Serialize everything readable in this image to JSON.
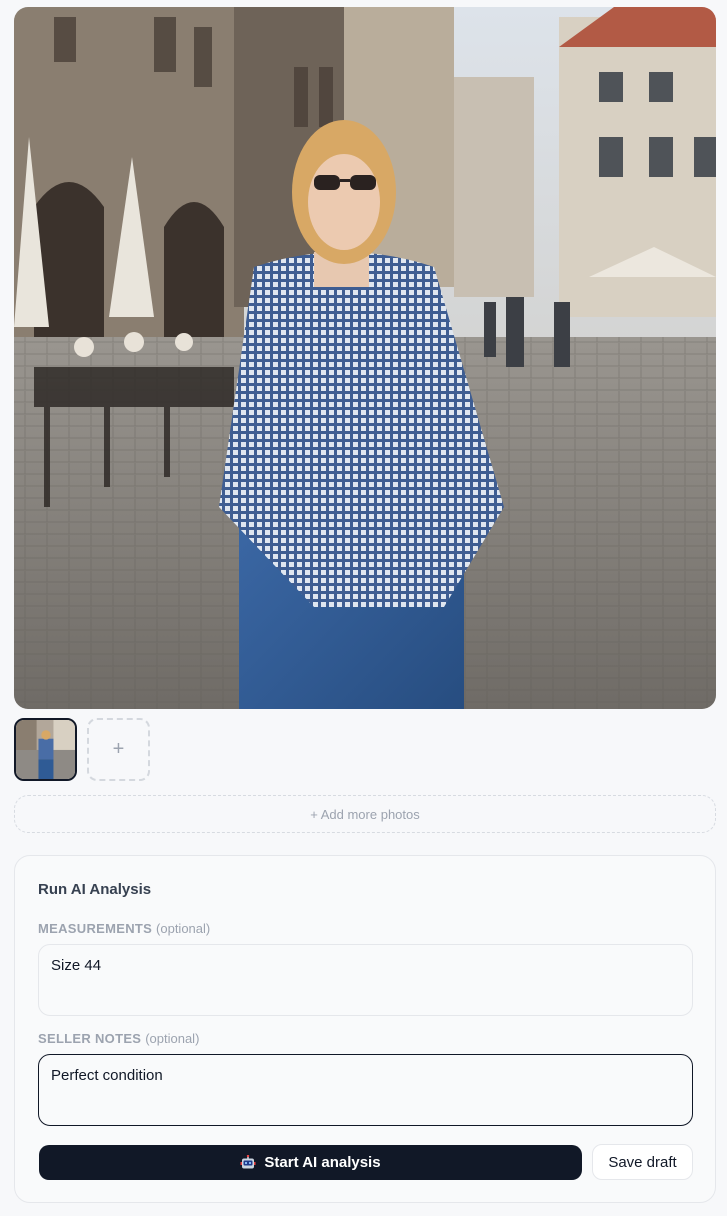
{
  "photos": {
    "main_alt": "",
    "thumbnail_count": 1,
    "add_thumb_label": "+",
    "add_more_label": "+ Add more photos"
  },
  "analysis": {
    "title": "Run AI Analysis",
    "measurements": {
      "label": "MEASUREMENTS",
      "optional": "(optional)",
      "value": "Size 44"
    },
    "seller_notes": {
      "label": "SELLER NOTES",
      "optional": "(optional)",
      "value": "Perfect condition"
    },
    "start_button": {
      "icon": "robot-icon",
      "label": "Start AI analysis"
    },
    "save_button": {
      "label": "Save draft"
    }
  },
  "colors": {
    "primary": "#111827",
    "muted": "#9ca3af",
    "border": "#e5e7eb",
    "background": "#f7f8fa"
  }
}
